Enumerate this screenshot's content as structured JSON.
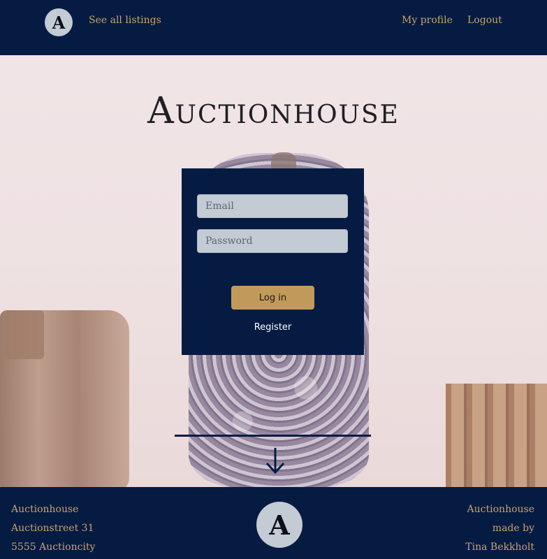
{
  "nav": {
    "logo_letter": "A",
    "listings_label": "See all listings",
    "profile_label": "My profile",
    "logout_label": "Logout"
  },
  "hero": {
    "title": "Auctionhouse"
  },
  "login": {
    "email_placeholder": "Email",
    "password_placeholder": "Password",
    "login_label": "Log in",
    "register_label": "Register"
  },
  "footer": {
    "left_line1": "Auctionhouse",
    "left_line2": "Auctionstreet 31",
    "left_line3": "5555 Auctioncity",
    "logo_letter": "A",
    "right_line1": "Auctionhouse",
    "right_line2": "made by",
    "right_line3": "Tina Bekkholt"
  },
  "colors": {
    "navy": "#051b42",
    "gold": "#c8a36c",
    "button_gold": "#c19a5b",
    "input_bg": "#c3cbd4"
  },
  "icons": {
    "down_arrow": "arrow-down-icon"
  }
}
